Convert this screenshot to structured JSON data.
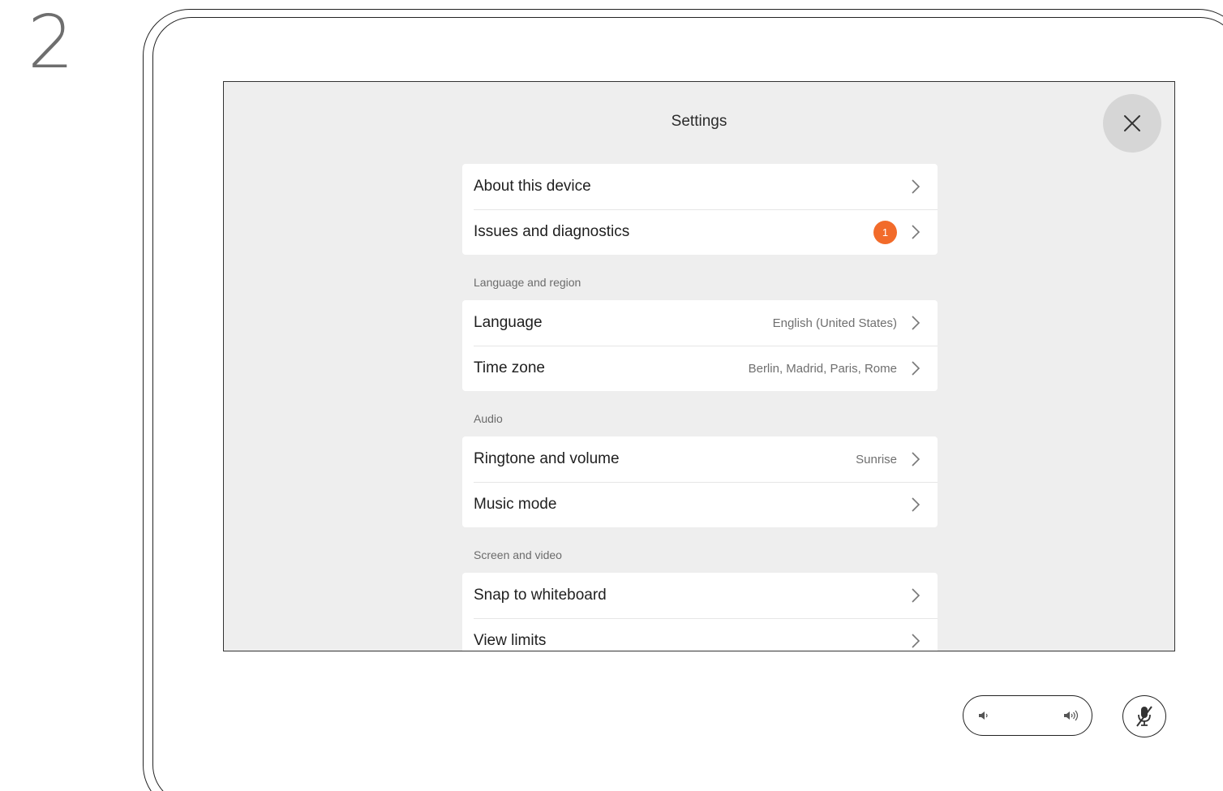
{
  "step_number": "2",
  "screen": {
    "title": "Settings",
    "close_icon": "close-icon",
    "groups": {
      "general": [
        {
          "label": "About this device",
          "value": ""
        },
        {
          "label": "Issues and diagnostics",
          "value": "",
          "badge": "1"
        }
      ],
      "language_region": {
        "header": "Language and region",
        "items": [
          {
            "label": "Language",
            "value": "English (United States)"
          },
          {
            "label": "Time zone",
            "value": "Berlin, Madrid, Paris, Rome"
          }
        ]
      },
      "audio": {
        "header": "Audio",
        "items": [
          {
            "label": "Ringtone and volume",
            "value": "Sunrise"
          },
          {
            "label": "Music mode",
            "value": ""
          }
        ]
      },
      "screen_video": {
        "header": "Screen and video",
        "items": [
          {
            "label": "Snap to whiteboard",
            "value": ""
          },
          {
            "label": "View limits",
            "value": ""
          }
        ]
      }
    }
  },
  "controls": {
    "volume_down_icon": "volume-down-icon",
    "volume_up_icon": "volume-up-icon",
    "mute_icon": "microphone-muted-icon"
  },
  "colors": {
    "screen_background": "#eeeeee",
    "badge": "#f26b2a",
    "close_button": "#d6d6d6"
  }
}
